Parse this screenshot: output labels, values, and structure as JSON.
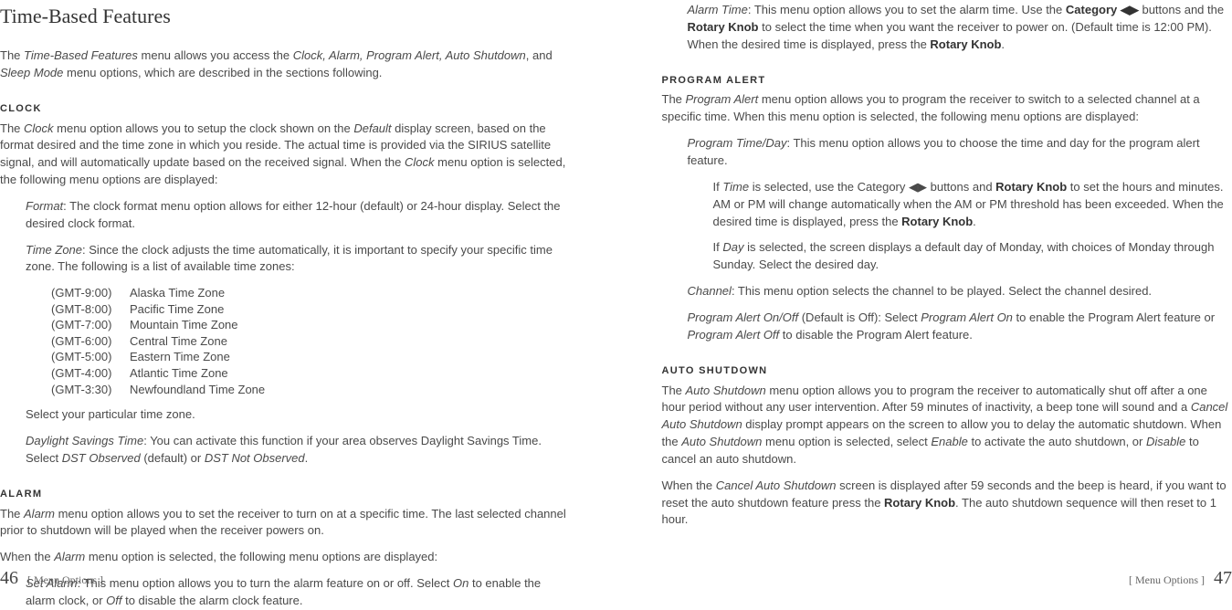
{
  "left": {
    "title": "Time-Based Features",
    "intro_1a": "The ",
    "intro_1b": "Time-Based Features",
    "intro_1c": " menu allows you access the ",
    "intro_1d": "Clock, Alarm, Program Alert, Auto Shutdown",
    "intro_1e": ", and ",
    "intro_1f": "Sleep Mode",
    "intro_1g": " menu options, which are described in the sections following.",
    "clock_heading": "CLOCK",
    "clock_p1a": "The ",
    "clock_p1b": "Clock",
    "clock_p1c": " menu option allows you to setup the clock shown on the ",
    "clock_p1d": "Default",
    "clock_p1e": " display screen, based on the format desired and the time zone in which you reside. The actual time is provided via the SIRIUS satellite signal, and will automatically update based on the received signal. When the ",
    "clock_p1f": "Clock",
    "clock_p1g": " menu option is selected, the following menu options are displayed:",
    "format_a": "Format",
    "format_b": ": The clock format menu option allows for either 12-hour (default) or 24-hour display. Select the desired clock format.",
    "tz_a": "Time Zone",
    "tz_b": ": Since the clock adjusts the time automatically, it is important to specify your specific time zone. The following is a list of available time zones:",
    "timezones": [
      {
        "offset": "(GMT-9:00)",
        "name": "Alaska Time Zone"
      },
      {
        "offset": "(GMT-8:00)",
        "name": "Pacific Time Zone"
      },
      {
        "offset": "(GMT-7:00)",
        "name": "Mountain Time Zone"
      },
      {
        "offset": "(GMT-6:00)",
        "name": "Central Time Zone"
      },
      {
        "offset": "(GMT-5:00)",
        "name": "Eastern Time Zone"
      },
      {
        "offset": "(GMT-4:00)",
        "name": "Atlantic Time Zone"
      },
      {
        "offset": "(GMT-3:30)",
        "name": "Newfoundland Time Zone"
      }
    ],
    "tz_select": "Select your particular time zone.",
    "dst_a": "Daylight Savings Time",
    "dst_b": ": You can activate this function if your area observes Daylight Savings Time. Select ",
    "dst_c": "DST Observed",
    "dst_d": " (default) or ",
    "dst_e": "DST Not Observed",
    "dst_f": ".",
    "alarm_heading": "ALARM",
    "alarm_p1a": "The ",
    "alarm_p1b": "Alarm",
    "alarm_p1c": " menu option allows you to set the receiver to turn on at a specific time. The last selected channel prior to shutdown will be played when the receiver powers on.",
    "alarm_p2a": "When the ",
    "alarm_p2b": "Alarm",
    "alarm_p2c": " menu option is selected, the following menu options are displayed:",
    "setalarm_a": "Set Alarm",
    "setalarm_b": ": This menu option allows you to turn the alarm feature on or off. Select ",
    "setalarm_c": "On",
    "setalarm_d": " to enable the alarm clock, or ",
    "setalarm_e": "Off",
    "setalarm_f": " to disable the alarm clock feature.",
    "footer_num": "46",
    "footer_label": "[ Menu Options ]"
  },
  "right": {
    "alarmtime_a": "Alarm Time",
    "alarmtime_b": ": This menu option allows you to set the alarm time. Use the ",
    "alarmtime_c": "Category ",
    "alarmtime_arrows": "◀▶",
    "alarmtime_d": " buttons and the ",
    "alarmtime_e": "Rotary Knob",
    "alarmtime_f": " to select the time when you want the receiver to power on. (Default time is 12:00 PM). When the desired time is displayed, press the ",
    "alarmtime_g": "Rotary Knob",
    "alarmtime_h": ".",
    "pa_heading": "PROGRAM ALERT",
    "pa_p1a": "The ",
    "pa_p1b": "Program Alert",
    "pa_p1c": " menu option allows you to program the receiver to switch to a selected channel at a specific time. When this menu option is selected, the following menu options are displayed:",
    "ptd_a": "Program Time/Day",
    "ptd_b": ": This menu option allows you to choose the time and day for the program alert feature.",
    "iftime_a": "If ",
    "iftime_b": "Time",
    "iftime_c": " is selected, use the Category ",
    "iftime_arrows": "◀▶",
    "iftime_d": " buttons and ",
    "iftime_e": "Rotary Knob",
    "iftime_f": " to set the hours and minutes. AM or PM will change automatically when the AM or PM threshold has been exceeded. When the desired time is displayed, press the ",
    "iftime_g": "Rotary Knob",
    "iftime_h": ".",
    "ifday_a": "If ",
    "ifday_b": "Day",
    "ifday_c": " is selected, the screen displays a default day of Monday, with choices of Monday through Sunday. Select the desired day.",
    "channel_a": "Channel",
    "channel_b": ": This menu option selects the channel to be played. Select the channel desired.",
    "onoff_a": "Program Alert On/Off",
    "onoff_b": " (Default is Off): Select ",
    "onoff_c": "Program Alert On",
    "onoff_d": " to enable the Program Alert feature or ",
    "onoff_e": "Program Alert Off",
    "onoff_f": " to disable the Program Alert feature.",
    "as_heading": "AUTO SHUTDOWN",
    "as_p1a": "The ",
    "as_p1b": "Auto Shutdown",
    "as_p1c": " menu option allows you to program the receiver to automatically shut off after a one hour period without any user intervention. After 59 minutes of inactivity, a beep tone will sound and a ",
    "as_p1d": "Cancel Auto Shutdown",
    "as_p1e": " display prompt appears on the screen to allow you to delay the automatic shutdown. When the ",
    "as_p1f": "Auto Shutdown",
    "as_p1g": " menu option is selected, select ",
    "as_p1h": "Enable",
    "as_p1i": " to activate the auto shutdown, or ",
    "as_p1j": "Disable",
    "as_p1k": " to cancel an auto shutdown.",
    "as_p2a": "When the ",
    "as_p2b": "Cancel Auto Shutdown",
    "as_p2c": " screen is displayed after 59 seconds and the beep is heard, if you want to reset the auto shutdown feature press the ",
    "as_p2d": "Rotary Knob",
    "as_p2e": ". The auto shutdown sequence will then reset to 1 hour.",
    "footer_label": "[ Menu Options ]",
    "footer_num": "47"
  }
}
